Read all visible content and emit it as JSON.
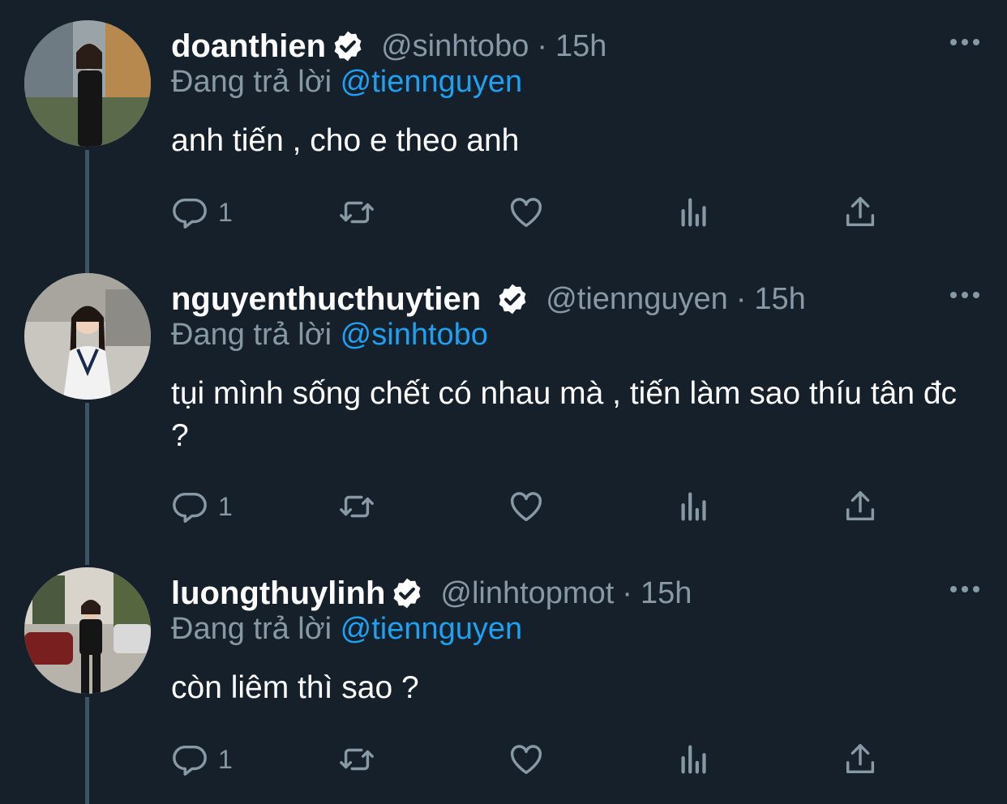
{
  "reply_label": "Đang trả lời",
  "tweets": [
    {
      "display_name": "doanthien",
      "handle": "@sinhtobo",
      "separator": "·",
      "time": "15h",
      "replying_to": "@tiennguyen",
      "text": "anh tiến , cho e theo anh",
      "reply_count": "1"
    },
    {
      "display_name": "nguyenthucthuytien",
      "handle": "@tiennguyen",
      "separator": "·",
      "time": "15h",
      "replying_to": "@sinhtobo",
      "text": "tụi mình sống chết có nhau mà , tiến làm sao thíu tân đc ?",
      "reply_count": "1"
    },
    {
      "display_name": "luongthuylinh",
      "handle": "@linhtopmot",
      "separator": "·",
      "time": "15h",
      "replying_to": "@tiennguyen",
      "text": "còn liêm thì sao ?",
      "reply_count": "1"
    }
  ],
  "icons": {
    "verified": "verified-badge-icon",
    "more": "more-dots-icon",
    "reply": "reply-icon",
    "retweet": "retweet-icon",
    "like": "heart-icon",
    "analytics": "analytics-icon",
    "share": "share-icon"
  },
  "colors": {
    "background": "#15202b",
    "secondary_text": "#8899a6",
    "link": "#1da1f2",
    "thread_line": "#3d5466"
  }
}
